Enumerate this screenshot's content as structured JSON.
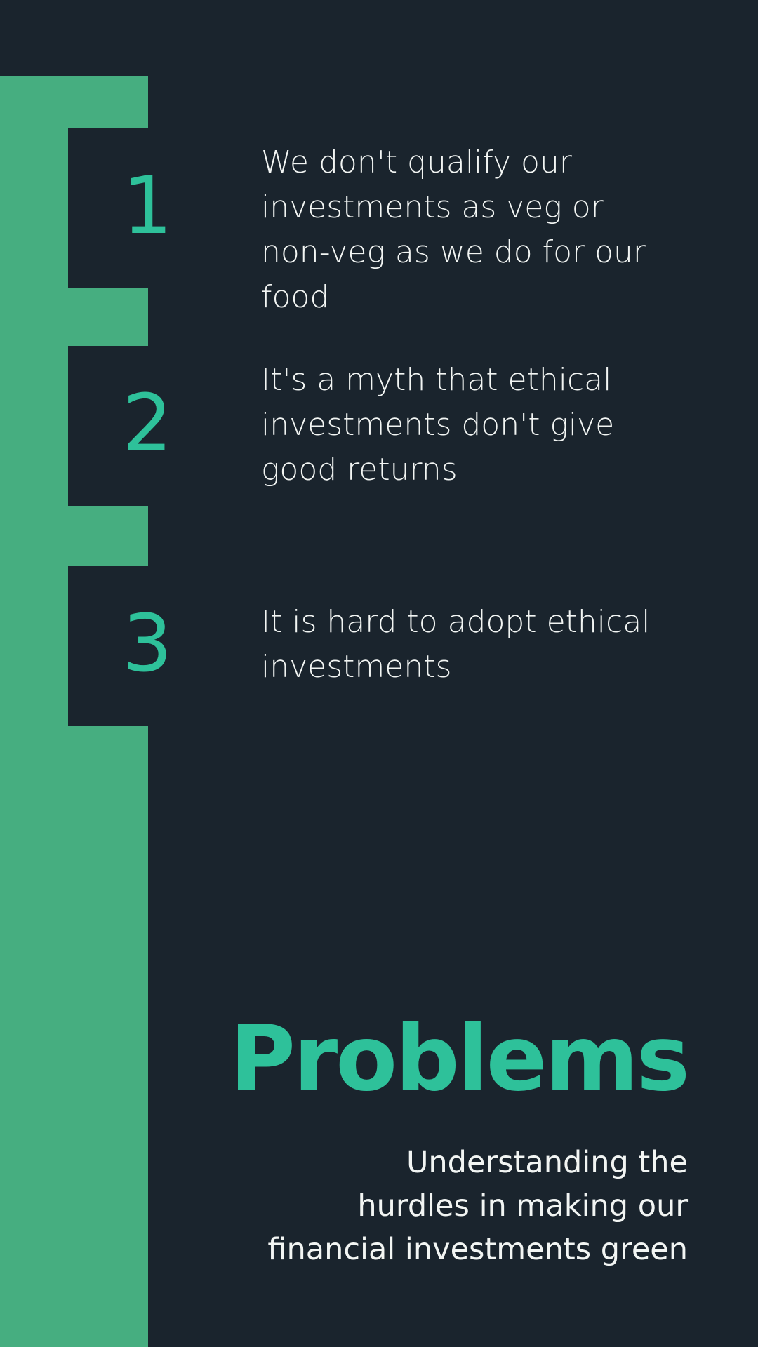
{
  "colors": {
    "background": "#1a242d",
    "accent_bar": "#46ae80",
    "accent_text": "#2ec19a",
    "body_text": "#f2f5f3"
  },
  "problems": [
    {
      "number": "1",
      "text": "We don't qualify our investments as veg or non-veg as we do for our food"
    },
    {
      "number": "2",
      "text": "It's a myth that ethical investments don't give good returns"
    },
    {
      "number": "3",
      "text": "It is hard to adopt ethical investments"
    }
  ],
  "title": "Problems",
  "subtitle_lines": [
    "Understanding the",
    "hurdles in making our",
    "financial investments green"
  ]
}
